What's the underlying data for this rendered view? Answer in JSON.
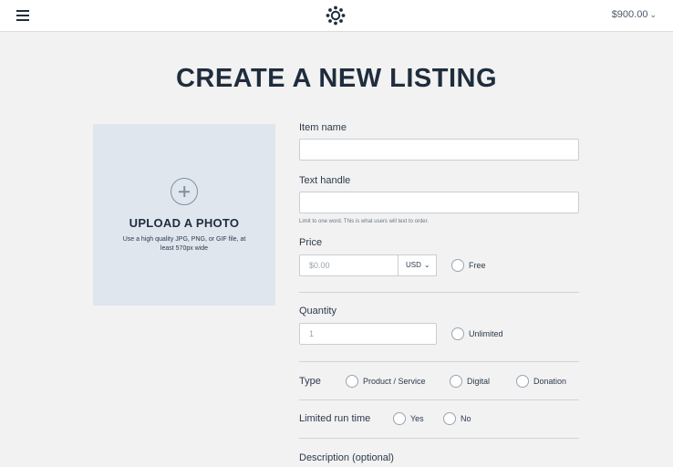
{
  "header": {
    "balance": "$900.00"
  },
  "page_title": "CREATE A NEW LISTING",
  "upload": {
    "title": "UPLOAD A PHOTO",
    "help": "Use a high quality JPG, PNG, or GIF file, at least 570px wide"
  },
  "form": {
    "item_name": {
      "label": "Item name",
      "value": ""
    },
    "text_handle": {
      "label": "Text handle",
      "value": "",
      "hint": "Limit to one word. This is what users will text to order."
    },
    "price": {
      "label": "Price",
      "placeholder": "$0.00",
      "currency": "USD",
      "free_label": "Free"
    },
    "quantity": {
      "label": "Quantity",
      "placeholder": "1",
      "unlimited_label": "Unlimited"
    },
    "type": {
      "label": "Type",
      "options": [
        "Product / Service",
        "Digital",
        "Donation"
      ]
    },
    "limited_run": {
      "label": "Limited run time",
      "options": [
        "Yes",
        "No"
      ]
    },
    "description": {
      "label": "Description (optional)"
    }
  }
}
